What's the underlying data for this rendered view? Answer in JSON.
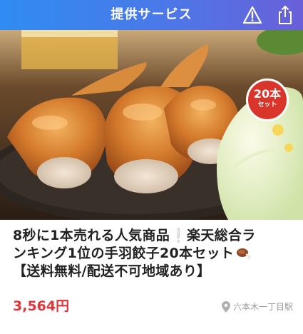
{
  "header": {
    "title": "提供サービス",
    "report_icon": "warning-triangle-icon",
    "share_icon": "share-icon",
    "gradient_colors": [
      "#2f8cf2",
      "#6a5fd8"
    ]
  },
  "product": {
    "badge_main": "20本",
    "badge_sub": "セット",
    "title_line1_a": "8秒に1本売れる人気商品",
    "title_line1_emoji": "❕",
    "title_line1_b": "楽天総合ラ",
    "title_line2": "ンキング1位の手羽餃子20本セット",
    "title_line2_icon": "meat-on-bone-icon",
    "title_line3": "【送料無料/配送不可地域あり】",
    "price": "3,564円",
    "price_color": "#e2333a",
    "location": "六本木一丁目駅",
    "location_icon": "map-pin-icon"
  }
}
